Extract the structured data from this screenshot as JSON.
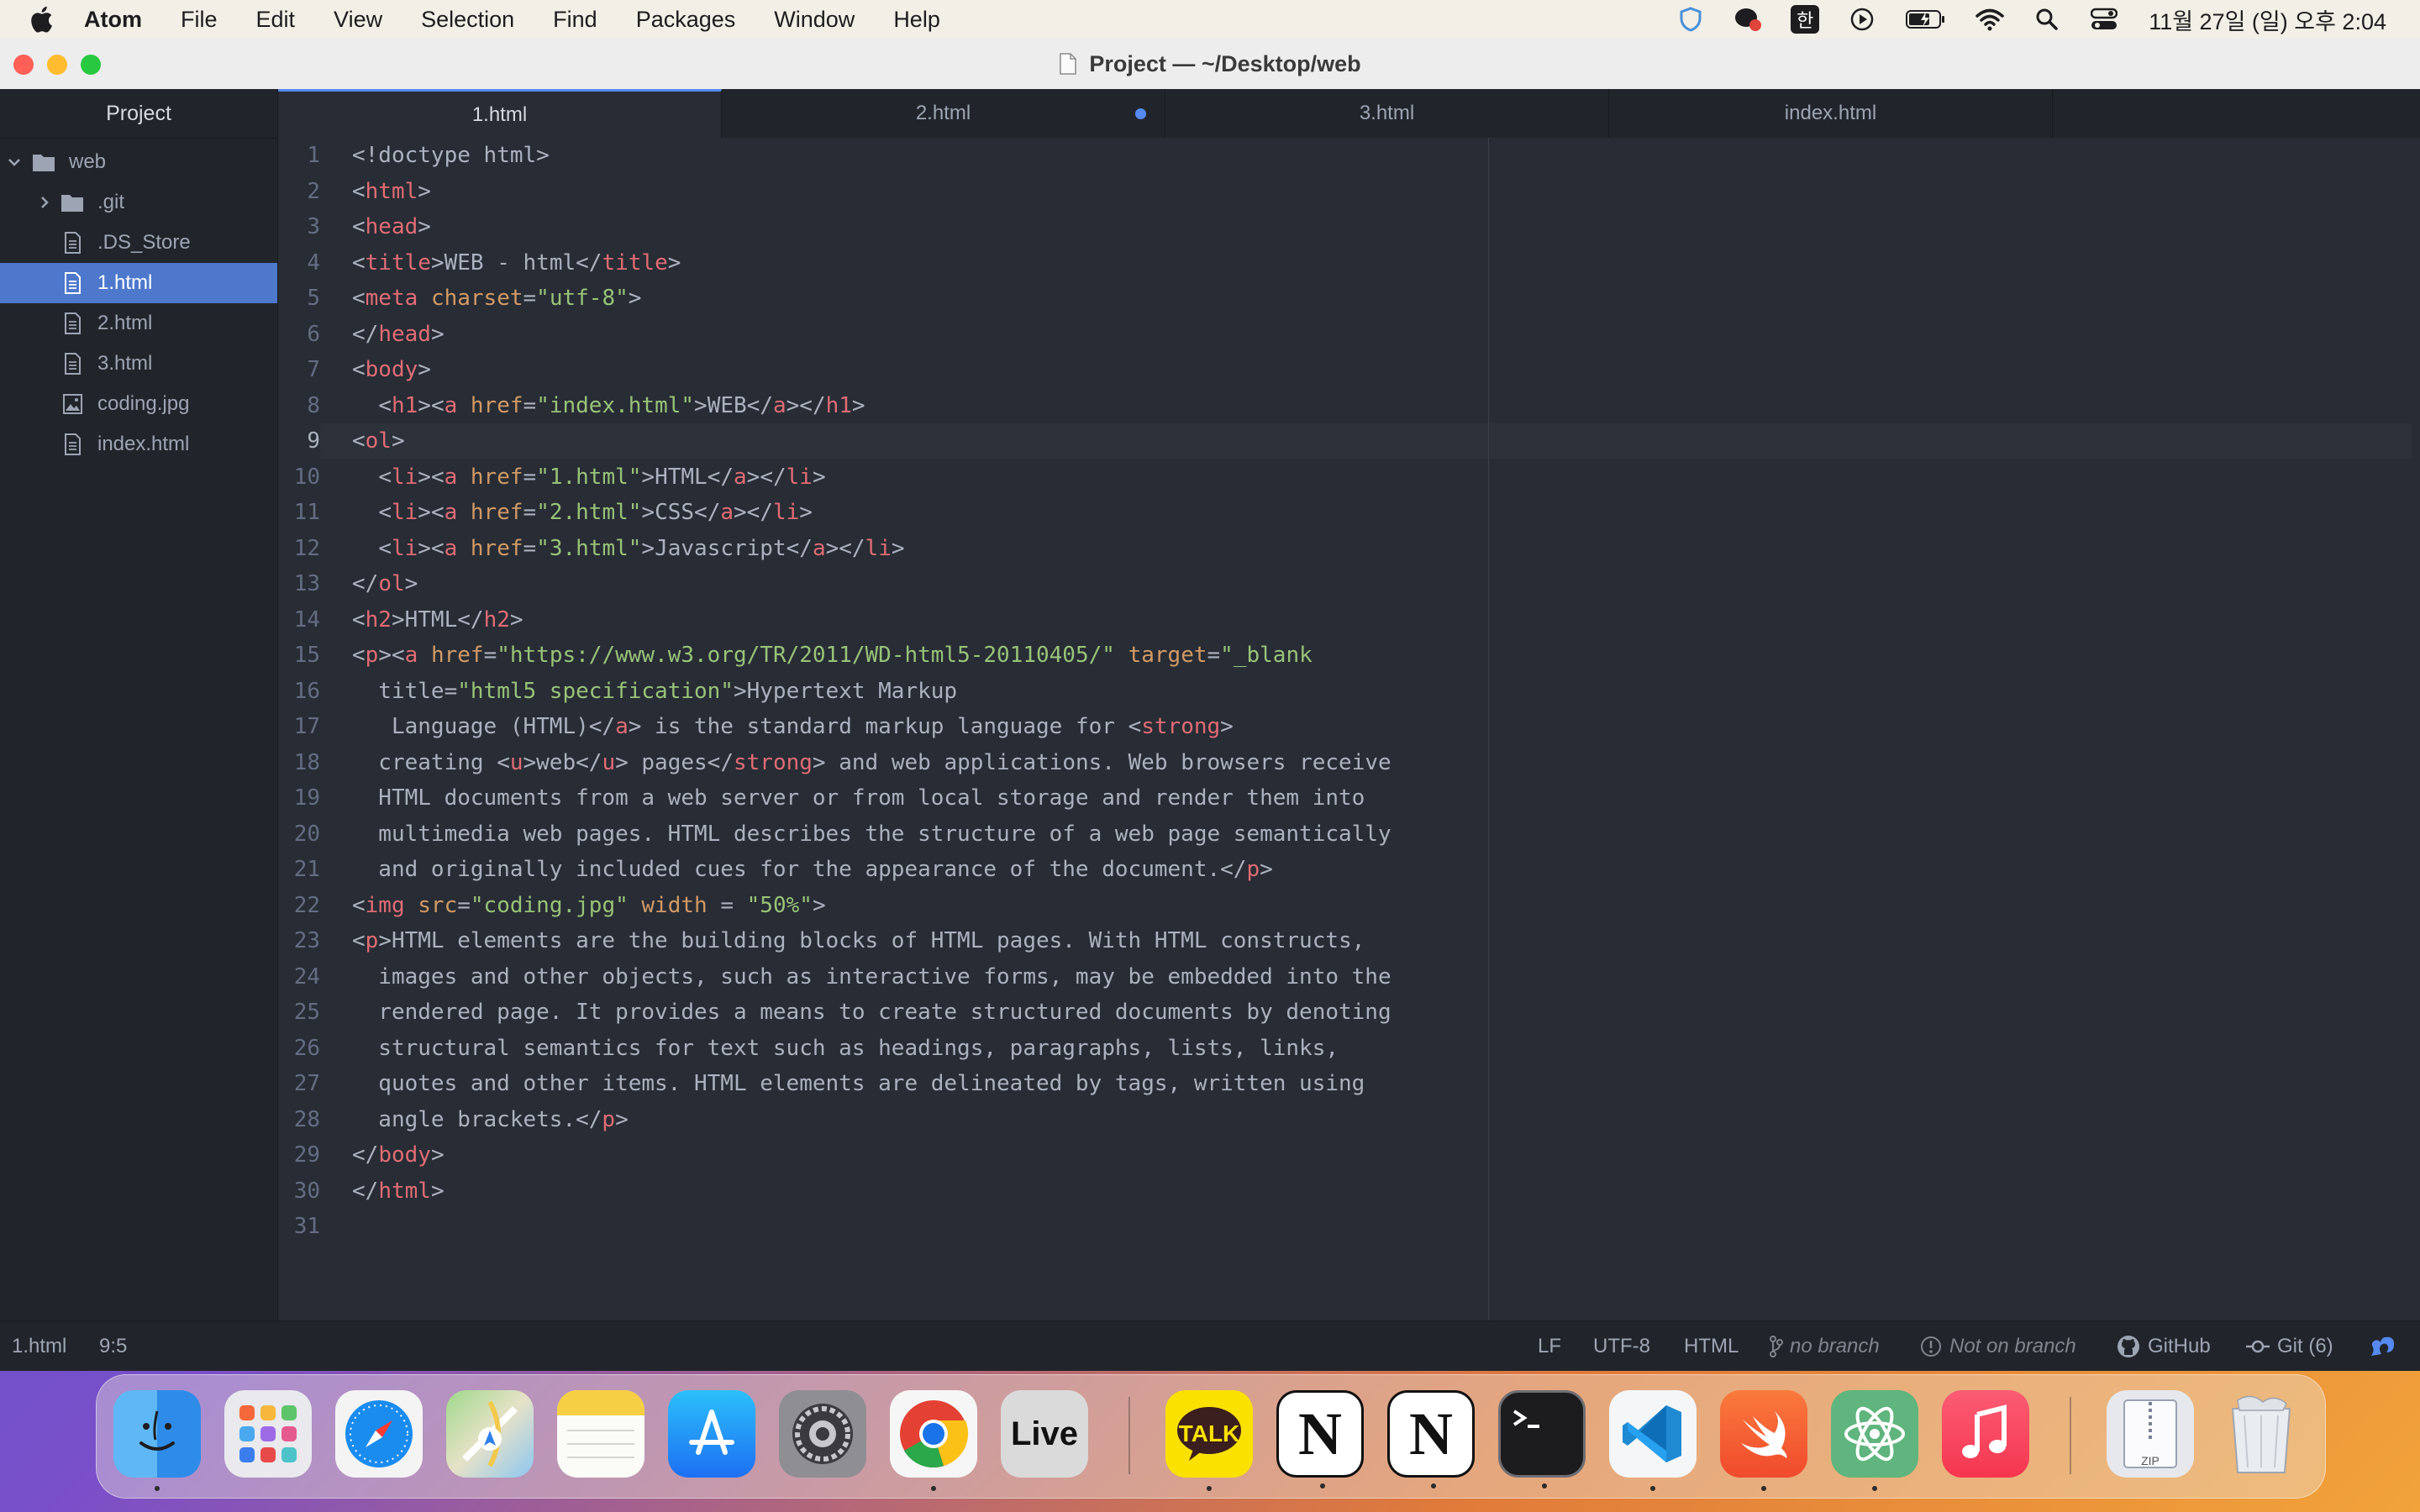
{
  "menubar": {
    "app_name": "Atom",
    "menus": [
      "File",
      "Edit",
      "View",
      "Selection",
      "Find",
      "Packages",
      "Window",
      "Help"
    ],
    "ime": "한",
    "clock": "11월 27일 (일) 오후 2:04",
    "icons": [
      "apple-icon",
      "shield-icon",
      "chat-bubble-icon",
      "input-method-icon",
      "play-icon",
      "battery-icon",
      "wifi-icon",
      "search-icon",
      "control-center-icon"
    ]
  },
  "window": {
    "title": "Project — ~/Desktop/web"
  },
  "tree": {
    "header": "Project",
    "root": "web",
    "items": [
      {
        "label": ".git",
        "type": "folder"
      },
      {
        "label": ".DS_Store",
        "type": "file"
      },
      {
        "label": "1.html",
        "type": "file",
        "selected": true
      },
      {
        "label": "2.html",
        "type": "file"
      },
      {
        "label": "3.html",
        "type": "file"
      },
      {
        "label": "coding.jpg",
        "type": "image"
      },
      {
        "label": "index.html",
        "type": "file"
      }
    ]
  },
  "tabs": [
    {
      "label": "1.html",
      "active": true,
      "modified": false
    },
    {
      "label": "2.html",
      "active": false,
      "modified": true
    },
    {
      "label": "3.html",
      "active": false,
      "modified": false
    },
    {
      "label": "index.html",
      "active": false,
      "modified": false
    }
  ],
  "editor": {
    "cursor_line": 9,
    "line_numbers": [
      "1",
      "2",
      "3",
      "4",
      "5",
      "6",
      "7",
      "8",
      "9",
      "10",
      "11",
      "12",
      "13",
      "14",
      "15",
      "16",
      "17",
      "18",
      "19",
      "20",
      "21",
      "22",
      "23",
      "24",
      "25",
      "26",
      "27",
      "28",
      "29",
      "30",
      "31"
    ],
    "lines": [
      "<!doctype html>",
      "<html>",
      "<head>",
      "<title>WEB - html</title>",
      "<meta charset=\"utf-8\">",
      "</head>",
      "<body>",
      "  <h1><a href=\"index.html\">WEB</a></h1>",
      "<ol>",
      "  <li><a href=\"1.html\">HTML</a></li>",
      "  <li><a href=\"2.html\">CSS</a></li>",
      "  <li><a href=\"3.html\">Javascript</a></li>",
      "</ol>",
      "<h2>HTML</h2>",
      "<p><a href=\"https://www.w3.org/TR/2011/WD-html5-20110405/\" target=\"_blank\"",
      "  title=\"html5 specification\">Hypertext Markup",
      "   Language (HTML)</a> is the standard markup language for <strong>",
      "  creating <u>web</u> pages</strong> and web applications. Web browsers receive",
      "  HTML documents from a web server or from local storage and render them into",
      "  multimedia web pages. HTML describes the structure of a web page semantically",
      "  and originally included cues for the appearance of the document.</p>",
      "<img src=\"coding.jpg\" width = \"50%\">",
      "<p>HTML elements are the building blocks of HTML pages. With HTML constructs,",
      "  images and other objects, such as interactive forms, may be embedded into the",
      "  rendered page. It provides a means to create structured documents by denoting",
      "  structural semantics for text such as headings, paragraphs, lists, links,",
      "  quotes and other items. HTML elements are delineated by tags, written using",
      "  angle brackets.</p>",
      "</body>",
      "</html>",
      ""
    ]
  },
  "statusbar": {
    "file": "1.html",
    "cursor": "9:5",
    "line_ending": "LF",
    "encoding": "UTF-8",
    "grammar": "HTML",
    "branch": "no branch",
    "branch_status": "Not on branch",
    "github": "GitHub",
    "git": "Git (6)"
  },
  "dock": {
    "apps": [
      "finder-icon",
      "launchpad-icon",
      "safari-icon",
      "maps-icon",
      "notes-icon",
      "app-store-icon",
      "system-settings-icon",
      "chrome-icon",
      "live-icon",
      "kakaotalk-icon",
      "notion-icon",
      "notion-icon-2",
      "terminal-icon",
      "vscode-icon",
      "swift-icon",
      "atom-icon",
      "music-icon",
      "archive-icon",
      "trash-icon"
    ],
    "live_label": "Live",
    "talk_label": "TALK",
    "notion_label": "N",
    "zip_label": "ZIP"
  },
  "colors": {
    "editor_bg": "#282c34",
    "panel_bg": "#21252b",
    "accent": "#568af2",
    "selection": "#4d78cc",
    "tag": "#e06c75",
    "attribute": "#d19a66",
    "string": "#98c379"
  }
}
